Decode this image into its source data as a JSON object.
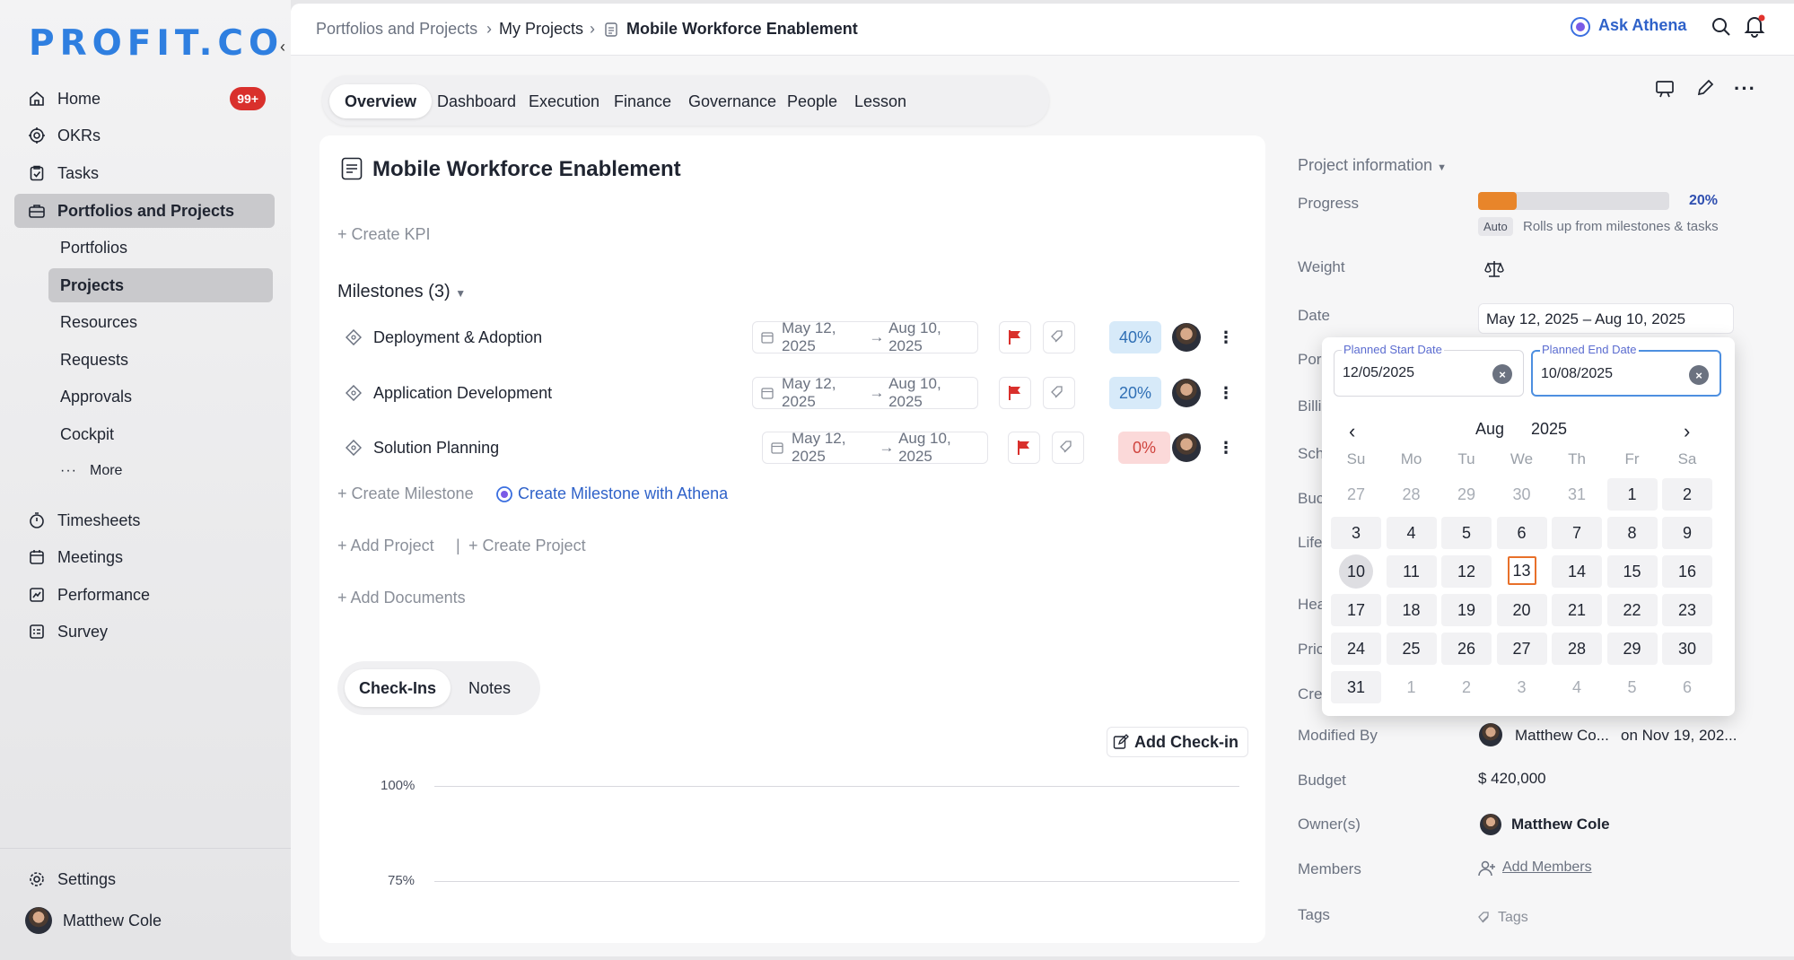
{
  "brand": {
    "logo": "PROFIT.CO"
  },
  "sidebar": {
    "items": [
      {
        "label": "Home",
        "badge": "99+"
      },
      {
        "label": "OKRs"
      },
      {
        "label": "Tasks"
      },
      {
        "label": "Portfolios and Projects"
      }
    ],
    "sub_items": [
      "Portfolios",
      "Projects",
      "Resources",
      "Requests",
      "Approvals",
      "Cockpit",
      "More"
    ],
    "items2": [
      "Timesheets",
      "Meetings",
      "Performance",
      "Survey"
    ],
    "settings": "Settings",
    "user": "Matthew Cole"
  },
  "breadcrumb": {
    "level1": "Portfolios and Projects",
    "level2": "My Projects",
    "current": "Mobile Workforce Enablement"
  },
  "header": {
    "ask_athena": "Ask Athena"
  },
  "tabs": [
    "Overview",
    "Dashboard",
    "Execution",
    "Finance",
    "Governance",
    "People",
    "Lesson"
  ],
  "project": {
    "title": "Mobile Workforce Enablement",
    "create_kpi": "Create KPI",
    "milestones_title": "Milestones",
    "milestones_count": "(3)",
    "milestones": [
      {
        "name": "Deployment & Adoption",
        "start": "May 12, 2025",
        "end": "Aug 10, 2025",
        "pct": "40%",
        "color": "#d7eaf9",
        "text": "#2f6fb5"
      },
      {
        "name": "Application Development",
        "start": "May 12, 2025",
        "end": "Aug 10, 2025",
        "pct": "20%",
        "color": "#d7eaf9",
        "text": "#2f6fb5"
      },
      {
        "name": "Solution Planning",
        "start": "May 12, 2025",
        "end": "Aug 10, 2025",
        "pct": "0%",
        "color": "#fbd9d9",
        "text": "#d0443e"
      }
    ],
    "create_milestone": "Create Milestone",
    "create_milestone_athena": "Create Milestone with Athena",
    "add_project": "Add Project",
    "create_project": "Create Project",
    "add_documents": "Add Documents",
    "subtabs": [
      "Check-Ins",
      "Notes"
    ],
    "add_checkin": "Add Check-in",
    "chart_ticks": [
      "100%",
      "75%"
    ]
  },
  "info": {
    "header": "Project information",
    "progress_label": "Progress",
    "progress_value": "20%",
    "progress_fraction": 0.2,
    "auto_badge": "Auto",
    "rollup_text": "Rolls up from milestones & tasks",
    "weight_label": "Weight",
    "date_label": "Date",
    "date_value": "May 12, 2025 – Aug 10, 2025",
    "hidden_labels": [
      "Por",
      "Billi",
      "Sch",
      "Buc",
      "Life",
      "Hea",
      "Pric",
      "Cre"
    ],
    "modified_label": "Modified By",
    "modified_user": "Matthew Co...",
    "modified_date": "on Nov 19, 202...",
    "budget_label": "Budget",
    "budget_value": "$ 420,000",
    "owners_label": "Owner(s)",
    "owner": "Matthew Cole",
    "members_label": "Members",
    "add_members": "Add Members",
    "tags_label": "Tags",
    "tags_value": "Tags"
  },
  "datepicker": {
    "start_label": "Planned Start Date",
    "start_value": "12/05/2025",
    "end_label": "Planned End Date",
    "end_value": "10/08/2025",
    "month": "Aug",
    "year": "2025",
    "weekdays": [
      "Su",
      "Mo",
      "Tu",
      "We",
      "Th",
      "Fr",
      "Sa"
    ],
    "weeks": [
      [
        "27",
        "28",
        "29",
        "30",
        "31",
        "1",
        "2"
      ],
      [
        "3",
        "4",
        "5",
        "6",
        "7",
        "8",
        "9"
      ],
      [
        "10",
        "11",
        "12",
        "13",
        "14",
        "15",
        "16"
      ],
      [
        "17",
        "18",
        "19",
        "20",
        "21",
        "22",
        "23"
      ],
      [
        "24",
        "25",
        "26",
        "27",
        "28",
        "29",
        "30"
      ],
      [
        "31",
        "1",
        "2",
        "3",
        "4",
        "5",
        "6"
      ]
    ],
    "today": "10",
    "selected": "13",
    "accent": "#e8702a"
  }
}
